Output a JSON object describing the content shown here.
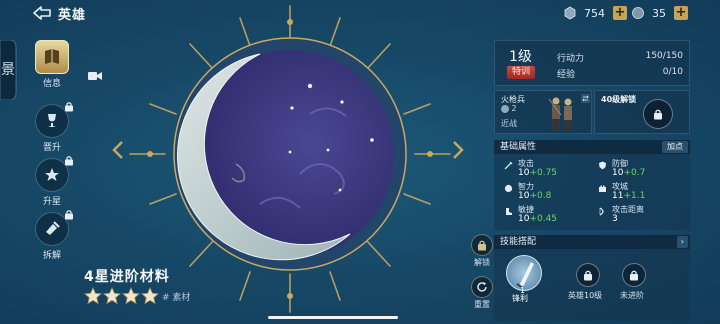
{
  "header": {
    "title": "英雄",
    "resource_1_value": "754",
    "resource_2_value": "35"
  },
  "nav": {
    "items": [
      {
        "label": "信息",
        "icon": "book-icon"
      },
      {
        "label": "晋升",
        "icon": "trophy-icon"
      },
      {
        "label": "升星",
        "icon": "star-up-icon"
      },
      {
        "label": "拆解",
        "icon": "disassemble-icon"
      }
    ]
  },
  "material": {
    "name": "4星进阶材料",
    "star_count": 4,
    "tag": "# 素材"
  },
  "actions": {
    "unlock_label": "解锁",
    "reset_label": "重置"
  },
  "panel": {
    "level": "1级",
    "tag": "特训",
    "stats": [
      {
        "name": "行动力",
        "value": "150/150"
      },
      {
        "name": "经验",
        "value": "0/10"
      }
    ],
    "unit": {
      "name": "火枪兵",
      "count": "2",
      "range": "近战"
    },
    "unlock_text": "40级解锁",
    "base_attr_title": "基础属性",
    "add_point_label": "加点",
    "attrs": [
      {
        "name": "攻击",
        "base": "10",
        "growth": "+0.75",
        "icon": "sword-icon"
      },
      {
        "name": "防御",
        "base": "10",
        "growth": "+0.7",
        "icon": "shield-icon"
      },
      {
        "name": "智力",
        "base": "10",
        "growth": "+0.8",
        "icon": "brain-icon"
      },
      {
        "name": "攻城",
        "base": "11",
        "growth": "+1.1",
        "icon": "siege-icon"
      },
      {
        "name": "敏捷",
        "base": "10",
        "growth": "+0.45",
        "icon": "boot-icon"
      },
      {
        "name": "攻击距离",
        "base": "3",
        "growth": "",
        "icon": "bow-icon"
      }
    ],
    "skill_title": "技能搭配",
    "skill": {
      "level": "1",
      "name": "锋利"
    },
    "locked_slots": [
      {
        "label": "英雄10级"
      },
      {
        "label": "未进阶"
      }
    ]
  },
  "colors": {
    "background": "#174a68",
    "gold_accent": "#c8a256",
    "growth_green": "#6fd36a",
    "tag_red": "#b33a2e"
  }
}
